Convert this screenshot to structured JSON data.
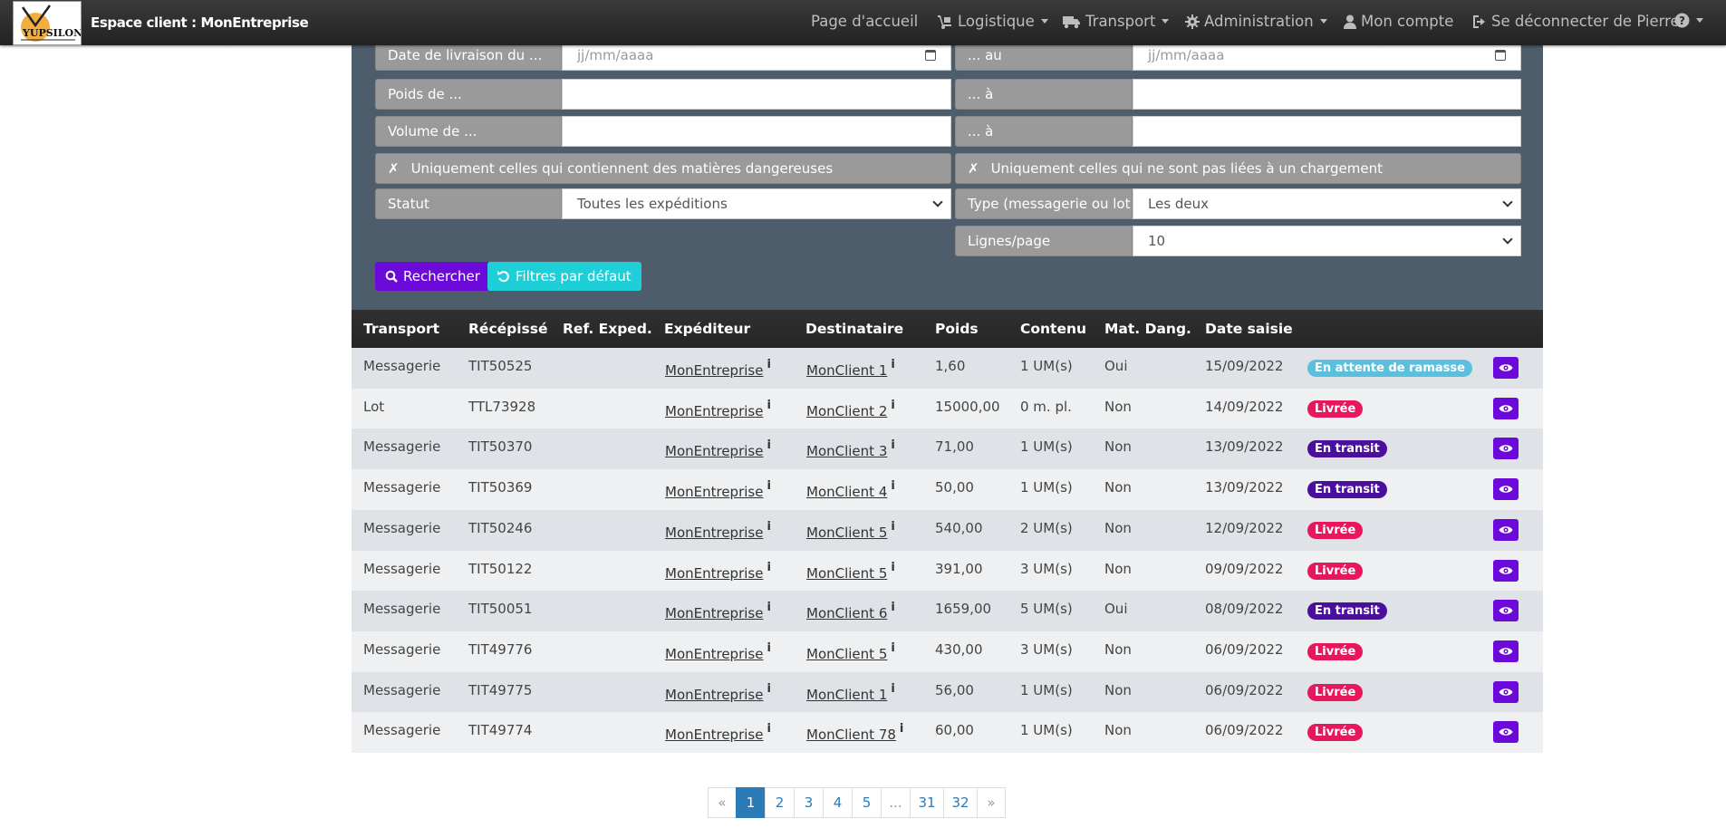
{
  "navbar": {
    "logo_text": "YUPSILON",
    "brand": "Espace client : MonEntreprise",
    "items": [
      {
        "label": "Page d'accueil",
        "icon": ""
      },
      {
        "label": "Logistique",
        "icon": "dolly-icon"
      },
      {
        "label": "Transport",
        "icon": "truck-icon"
      },
      {
        "label": "Administration",
        "icon": "gear-icon"
      },
      {
        "label": "Mon compte",
        "icon": "user-icon"
      },
      {
        "label": "Se déconnecter de Pierre",
        "icon": "logout-icon"
      }
    ],
    "help_icon": "question-circle-icon"
  },
  "filters": {
    "delivery_from_label": "Date de livraison du ...",
    "delivery_from_placeholder": "jj/mm/aaaa",
    "delivery_to_label": "... au",
    "delivery_to_placeholder": "jj/mm/aaaa",
    "weight_from_label": "Poids de ...",
    "weight_to_label": "... à",
    "volume_from_label": "Volume de ...",
    "volume_to_label": "... à",
    "dangerous_only": "Uniquement celles qui contiennent des matières dangereuses",
    "unlinked_only": "Uniquement celles qui ne sont pas liées à un chargement",
    "check_mark": "✗",
    "status_label": "Statut",
    "status_value": "Toutes les expéditions",
    "type_label": "Type (messagerie ou lot)",
    "type_value": "Les deux",
    "lines_label": "Lignes/page",
    "lines_value": "10",
    "search_button": "Rechercher",
    "reset_button": "Filtres par défaut"
  },
  "table": {
    "headers": [
      "Transport",
      "Récépissé",
      "Ref. Exped.",
      "Expéditeur",
      "Destinataire",
      "Poids",
      "Contenu",
      "Mat. Dang.",
      "Date saisie"
    ],
    "info_glyph": "i",
    "rows": [
      {
        "transport": "Messagerie",
        "recepisse": "TIT50525",
        "ref": "",
        "expediteur": "MonEntreprise",
        "destinataire": "MonClient 1",
        "poids": "1,60",
        "contenu": "1 UM(s)",
        "matdang": "Oui",
        "date": "15/09/2022",
        "statut": "En attente de ramasse",
        "statut_color": "#5bc0de"
      },
      {
        "transport": "Lot",
        "recepisse": "TTL73928",
        "ref": "",
        "expediteur": "MonEntreprise",
        "destinataire": "MonClient 2",
        "poids": "15000,00",
        "contenu": "0 m. pl.",
        "matdang": "Non",
        "date": "14/09/2022",
        "statut": "Livrée",
        "statut_color": "#e8175d"
      },
      {
        "transport": "Messagerie",
        "recepisse": "TIT50370",
        "ref": "",
        "expediteur": "MonEntreprise",
        "destinataire": "MonClient 3",
        "poids": "71,00",
        "contenu": "1 UM(s)",
        "matdang": "Non",
        "date": "13/09/2022",
        "statut": "En transit",
        "statut_color": "#4b0f9e"
      },
      {
        "transport": "Messagerie",
        "recepisse": "TIT50369",
        "ref": "",
        "expediteur": "MonEntreprise",
        "destinataire": "MonClient 4",
        "poids": "50,00",
        "contenu": "1 UM(s)",
        "matdang": "Non",
        "date": "13/09/2022",
        "statut": "En transit",
        "statut_color": "#4b0f9e"
      },
      {
        "transport": "Messagerie",
        "recepisse": "TIT50246",
        "ref": "",
        "expediteur": "MonEntreprise",
        "destinataire": "MonClient 5",
        "poids": "540,00",
        "contenu": "2 UM(s)",
        "matdang": "Non",
        "date": "12/09/2022",
        "statut": "Livrée",
        "statut_color": "#e8175d"
      },
      {
        "transport": "Messagerie",
        "recepisse": "TIT50122",
        "ref": "",
        "expediteur": "MonEntreprise",
        "destinataire": "MonClient 5",
        "poids": "391,00",
        "contenu": "3 UM(s)",
        "matdang": "Non",
        "date": "09/09/2022",
        "statut": "Livrée",
        "statut_color": "#e8175d"
      },
      {
        "transport": "Messagerie",
        "recepisse": "TIT50051",
        "ref": "",
        "expediteur": "MonEntreprise",
        "destinataire": "MonClient 6",
        "poids": "1659,00",
        "contenu": "5 UM(s)",
        "matdang": "Oui",
        "date": "08/09/2022",
        "statut": "En transit",
        "statut_color": "#4b0f9e"
      },
      {
        "transport": "Messagerie",
        "recepisse": "TIT49776",
        "ref": "",
        "expediteur": "MonEntreprise",
        "destinataire": "MonClient 5",
        "poids": "430,00",
        "contenu": "3 UM(s)",
        "matdang": "Non",
        "date": "06/09/2022",
        "statut": "Livrée",
        "statut_color": "#e8175d"
      },
      {
        "transport": "Messagerie",
        "recepisse": "TIT49775",
        "ref": "",
        "expediteur": "MonEntreprise",
        "destinataire": "MonClient 1",
        "poids": "56,00",
        "contenu": "1 UM(s)",
        "matdang": "Non",
        "date": "06/09/2022",
        "statut": "Livrée",
        "statut_color": "#e8175d"
      },
      {
        "transport": "Messagerie",
        "recepisse": "TIT49774",
        "ref": "",
        "expediteur": "MonEntreprise",
        "destinataire": "MonClient 78",
        "poids": "60,00",
        "contenu": "1 UM(s)",
        "matdang": "Non",
        "date": "06/09/2022",
        "statut": "Livrée",
        "statut_color": "#e8175d"
      }
    ]
  },
  "pagination": {
    "prev": "«",
    "pages": [
      "1",
      "2",
      "3",
      "4",
      "5",
      "...",
      "31",
      "32"
    ],
    "active": "1",
    "next": "»"
  },
  "colors": {
    "primary": "#6b0ad9",
    "info": "#1ecfd8",
    "panel": "#4e5d6c",
    "link": "#2c7bb6"
  }
}
